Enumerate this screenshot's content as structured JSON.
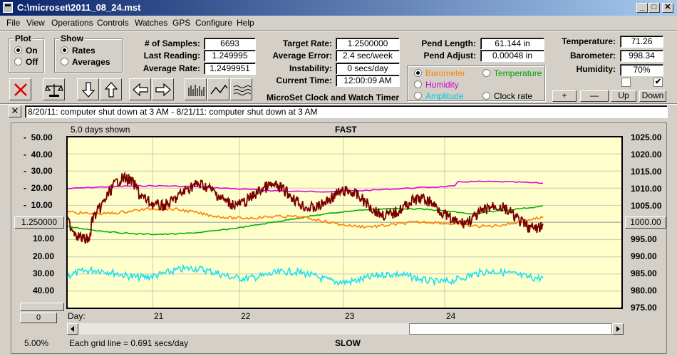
{
  "window": {
    "title": "C:\\microset\\2011_08_24.mst",
    "minimize": "_",
    "maximize": "□",
    "close": "✕"
  },
  "menu": [
    "File",
    "View",
    "Operations",
    "Controls",
    "Watches",
    "GPS",
    "Configure",
    "Help"
  ],
  "plot_group": {
    "title": "Plot",
    "on": "On",
    "off": "Off",
    "selected": "On"
  },
  "show_group": {
    "title": "Show",
    "rates": "Rates",
    "averages": "Averages",
    "selected": "Rates"
  },
  "stats": {
    "samples_label": "# of Samples:",
    "samples": "6693",
    "last_reading_label": "Last Reading:",
    "last_reading": "1.249995",
    "average_rate_label": "Average Rate:",
    "average_rate": "1.2499951",
    "target_rate_label": "Target Rate:",
    "target_rate": "1.2500000",
    "average_error_label": "Average Error:",
    "average_error": "2.4 sec/week",
    "instability_label": "Instability:",
    "instability": "0 secs/day",
    "current_time_label": "Current Time:",
    "current_time": "12:00:09 AM",
    "app_name": "MicroSet Clock and Watch Timer",
    "pend_length_label": "Pend Length:",
    "pend_length": "61.144 in",
    "pend_adjust_label": "Pend Adjust:",
    "pend_adjust": "0.00048 in",
    "temperature_label": "Temperature:",
    "temperature": "71.26",
    "barometer_label": "Barometer:",
    "barometer": "998.34",
    "humidity_label": "Humidity:",
    "humidity": "70%"
  },
  "overlay_select": {
    "barometer": "Barometer",
    "temperature": "Temperature",
    "humidity": "Humidity",
    "amplitude": "Amplitude",
    "clock_rate": "Clock rate",
    "selected": "Barometer"
  },
  "scale_buttons": {
    "plus": "+",
    "minus": "—",
    "up": "Up",
    "down": "Down"
  },
  "checkboxes": {
    "left_checked": false,
    "right_checked": true
  },
  "notes": {
    "close": "✕",
    "text": "8/20/11: computer shut down at 3 AM  -  8/21/11: computer shut down at 3 AM"
  },
  "plot": {
    "days_shown": "5.0 days shown",
    "fast_label": "FAST",
    "slow_label": "SLOW",
    "rate_center": "1.250000",
    "bottom_center": "0",
    "baro_center": "1000.00",
    "day_label": "Day:",
    "zoom": "5.00%",
    "grid_note": "Each grid line = 0.691 secs/day",
    "left_top": [
      "50.00",
      "40.00",
      "30.00",
      "20.00",
      "10.00"
    ],
    "left_bottom": [
      "10.00",
      "20.00",
      "30.00",
      "40.00"
    ],
    "right_ticks": [
      "1025.00",
      "1020.00",
      "1015.00",
      "1010.00",
      "1005.00",
      "995.00",
      "990.00",
      "985.00",
      "980.00",
      "975.00"
    ],
    "days": [
      "21",
      "22",
      "23",
      "24"
    ],
    "colors": {
      "background": "#ffffcc",
      "grid": "#c8c8b4",
      "rate": "#7a0000",
      "barometer": "#ff8000",
      "temperature": "#00b000",
      "humidity": "#e000e0",
      "amplitude": "#20e0f0"
    }
  }
}
